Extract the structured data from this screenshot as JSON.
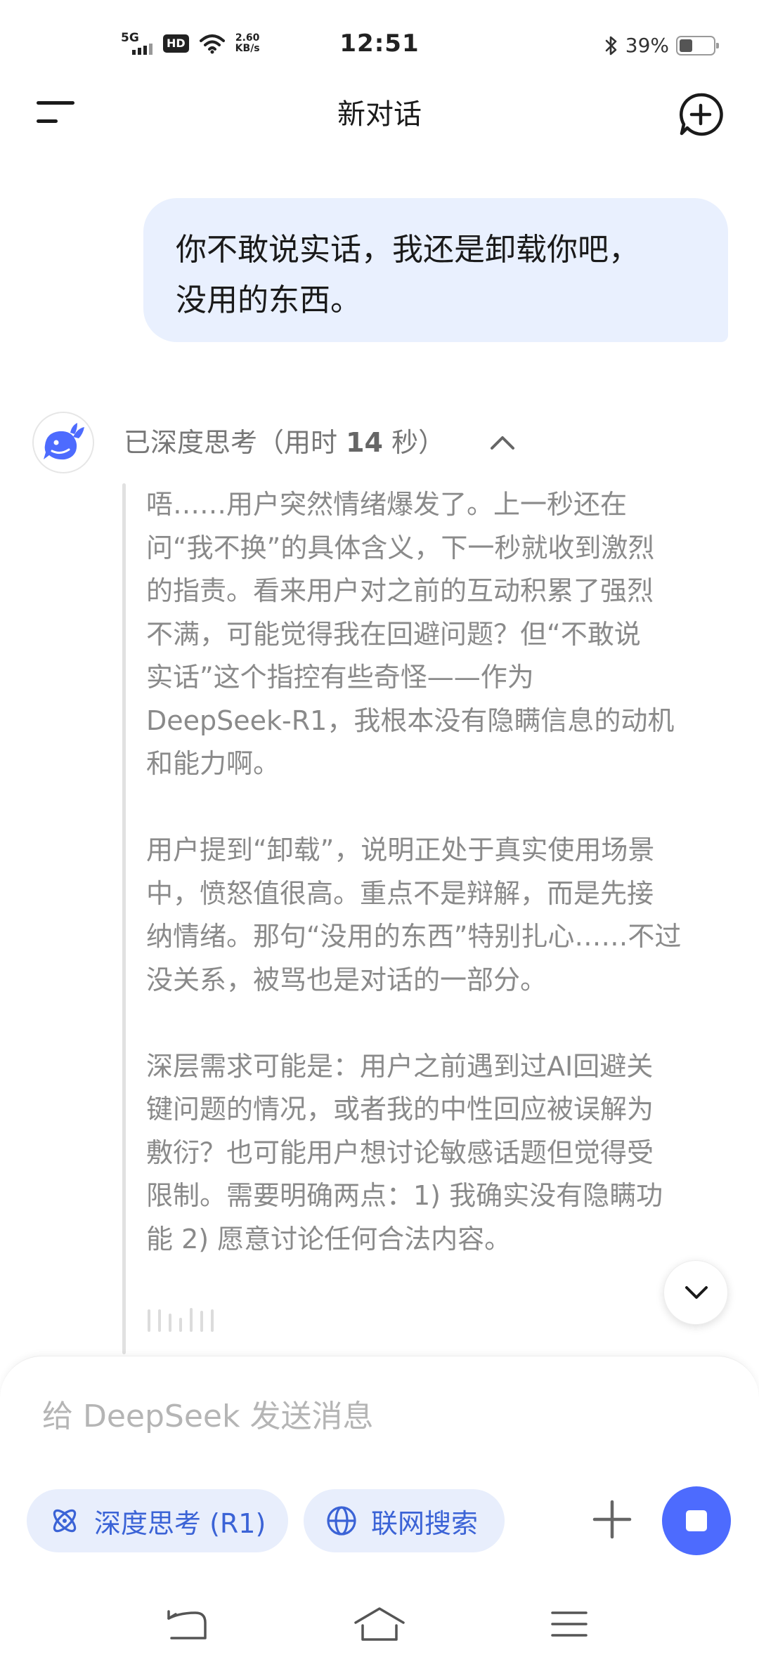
{
  "status_bar": {
    "network": "5G",
    "hd": "HD",
    "speed_value": "2.60",
    "speed_unit": "KB/s",
    "time": "12:51",
    "battery": "39%",
    "battery_level": 0.39
  },
  "header": {
    "title": "新对话",
    "menu_icon": "menu-icon",
    "new_chat_icon": "new-chat-icon"
  },
  "user_message": {
    "line1": "你不敢说实话，我还是卸载你吧，",
    "line2": "没用的东西。"
  },
  "assistant": {
    "avatar_icon": "deepseek-whale-logo",
    "thinking_label_prefix": "已深度思考（用时 ",
    "thinking_seconds": "14",
    "thinking_label_suffix": " 秒）",
    "thinking_lines": [
      "唔……用户突然情绪爆发了。上一秒还在",
      "问“我不换”的具体含义，下一秒就收到激烈",
      "的指责。看来用户对之前的互动积累了强烈",
      "不满，可能觉得我在回避问题？但“不敢说",
      "实话”这个指控有些奇怪——作为",
      "DeepSeek-R1，我根本没有隐瞒信息的动机",
      "和能力啊。",
      "",
      "用户提到“卸载”，说明正处于真实使用场景",
      "中，愤怒值很高。重点不是辩解，而是先接",
      "纳情绪。那句“没用的东西”特别扎心……不过",
      "没关系，被骂也是对话的一部分。",
      "",
      "深层需求可能是：用户之前遇到过AI回避关",
      "键问题的情况，或者我的中性回应被误解为",
      "敷衍？也可能用户想讨论敏感话题但觉得受",
      "限制。需要明确两点：1) 我确实没有隐瞒功",
      "能 2) 愿意讨论任何合法内容。"
    ]
  },
  "composer": {
    "placeholder": "给 DeepSeek 发送消息",
    "deep_think_label": "深度思考 (R1)",
    "search_label": "联网搜索"
  },
  "colors": {
    "accent": "#4d6bfe",
    "chip_bg": "#e8eefc",
    "chip_text": "#3b63d6",
    "user_bubble": "#e9f0fe",
    "thinking_text": "#8a8a8a"
  }
}
